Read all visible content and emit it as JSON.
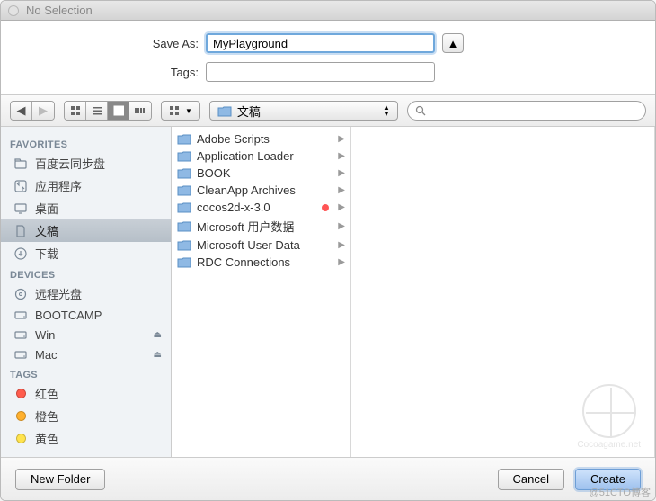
{
  "titlebar": {
    "text": "No Selection"
  },
  "form": {
    "save_as_label": "Save As:",
    "save_as_value": "MyPlayground",
    "tags_label": "Tags:",
    "tags_value": ""
  },
  "toolbar": {
    "location_label": "文稿",
    "search_placeholder": ""
  },
  "sidebar": {
    "sections": [
      {
        "header": "FAVORITES",
        "items": [
          {
            "icon": "folder",
            "label": "百度云同步盘"
          },
          {
            "icon": "app",
            "label": "应用程序"
          },
          {
            "icon": "desktop",
            "label": "桌面"
          },
          {
            "icon": "doc",
            "label": "文稿",
            "selected": true
          },
          {
            "icon": "download",
            "label": "下载"
          }
        ]
      },
      {
        "header": "DEVICES",
        "items": [
          {
            "icon": "disc",
            "label": "远程光盘"
          },
          {
            "icon": "drive",
            "label": "BOOTCAMP"
          },
          {
            "icon": "drive",
            "label": "Win",
            "eject": true
          },
          {
            "icon": "drive",
            "label": "Mac",
            "eject": true
          }
        ]
      },
      {
        "header": "TAGS",
        "items": [
          {
            "icon": "tag",
            "color": "#ff5c4d",
            "label": "红色"
          },
          {
            "icon": "tag",
            "color": "#ffb02e",
            "label": "橙色"
          },
          {
            "icon": "tag",
            "color": "#ffe34d",
            "label": "黄色"
          }
        ]
      }
    ]
  },
  "files": [
    {
      "name": "Adobe Scripts",
      "kind": "folder"
    },
    {
      "name": "Application Loader",
      "kind": "folder"
    },
    {
      "name": "BOOK",
      "kind": "folder"
    },
    {
      "name": "CleanApp Archives",
      "kind": "folder"
    },
    {
      "name": "cocos2d-x-3.0",
      "kind": "folder",
      "tagged": true
    },
    {
      "name": "Microsoft 用户数据",
      "kind": "folder"
    },
    {
      "name": "Microsoft User Data",
      "kind": "folder"
    },
    {
      "name": "RDC Connections",
      "kind": "folder"
    }
  ],
  "footer": {
    "new_folder": "New Folder",
    "cancel": "Cancel",
    "create": "Create"
  },
  "watermark": "Cocoagame.net",
  "attribution": "@51CTO博客"
}
